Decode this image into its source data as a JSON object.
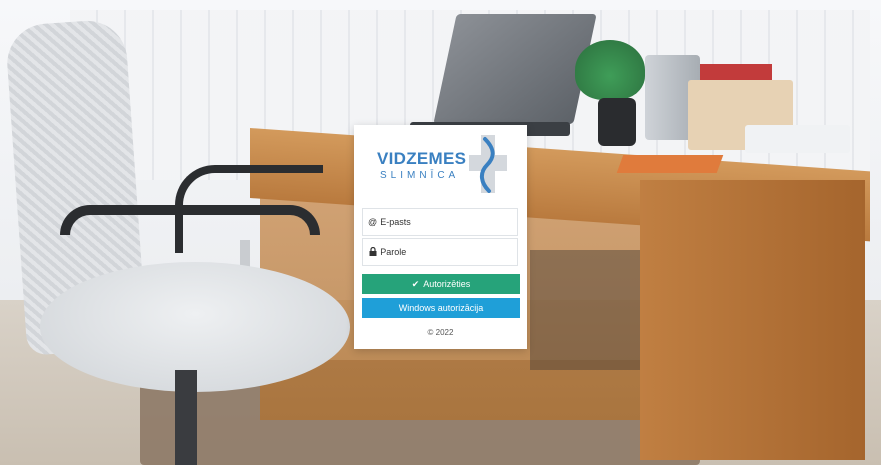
{
  "logo": {
    "line1": "VIDZEMES",
    "line2": "SLIMNĪCA",
    "brand_color": "#3a80c1",
    "cross_color": "#cfd3d8"
  },
  "form": {
    "email_placeholder": "E-pasts",
    "email_icon": "at-icon",
    "password_placeholder": "Parole",
    "password_icon": "lock-icon"
  },
  "buttons": {
    "authorize_label": "Autorizēties",
    "authorize_color": "#26a37a",
    "windows_label": "Windows autorizācija",
    "windows_color": "#1f9fd8"
  },
  "footer": {
    "copyright": "© 2022"
  }
}
